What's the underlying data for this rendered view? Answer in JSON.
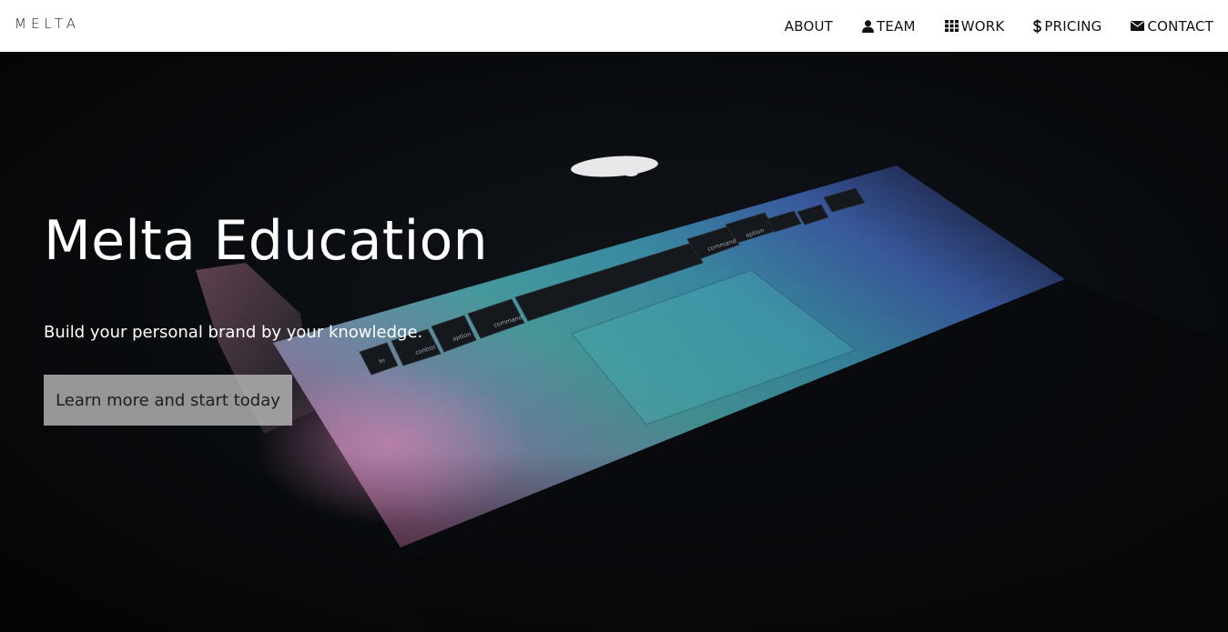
{
  "brand": {
    "name": "MELTA"
  },
  "nav": {
    "items": [
      {
        "label": "ABOUT",
        "icon": ""
      },
      {
        "label": "TEAM",
        "icon": "user-icon"
      },
      {
        "label": "WORK",
        "icon": "grid-icon"
      },
      {
        "label": "PRICING",
        "icon": "dollar-icon"
      },
      {
        "label": "CONTACT",
        "icon": "envelope-icon"
      }
    ]
  },
  "hero": {
    "title": "Melta Education",
    "subtitle": "Build your personal brand by your knowledge.",
    "cta_label": "Learn more and start today",
    "keyboard_keys": [
      "fn",
      "control",
      "option",
      "command",
      "command",
      "option"
    ]
  },
  "colors": {
    "topbar_bg": "#ffffff",
    "hero_bg": "#06080b",
    "cta_bg": "#bebebe"
  }
}
